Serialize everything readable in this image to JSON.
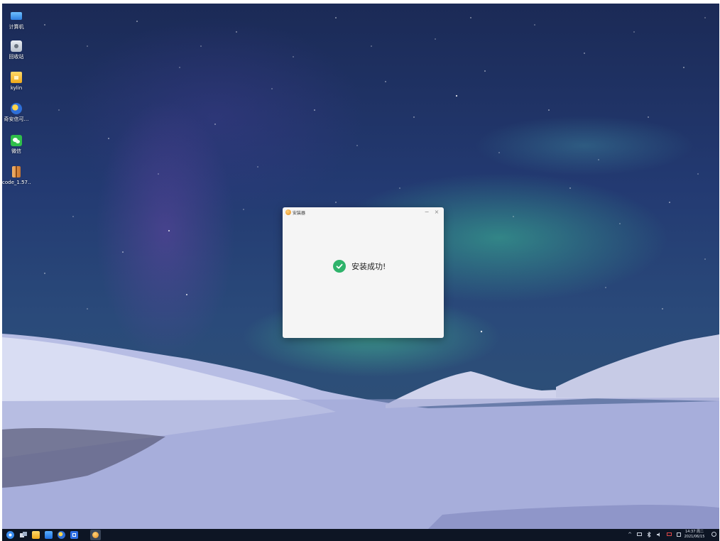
{
  "desktop": {
    "icons": [
      {
        "label": "计算机",
        "icon": "computer-icon"
      },
      {
        "label": "回收站",
        "icon": "trash-icon"
      },
      {
        "label": "kylin",
        "icon": "home-folder-icon"
      },
      {
        "label": "奇安信可…",
        "icon": "qianxin-browser-icon"
      },
      {
        "label": "微信",
        "icon": "wechat-icon"
      },
      {
        "label": "code_1.57…",
        "icon": "package-icon"
      }
    ]
  },
  "dialog": {
    "title": "安装器",
    "minimize_glyph": "−",
    "close_glyph": "×",
    "message": "安装成功!",
    "accent_color": "#2fb36b"
  },
  "taskbar": {
    "apps": [
      "start-menu-icon",
      "multitask-view-icon",
      "file-manager-icon",
      "software-store-icon",
      "browser-icon",
      "wps-writer-icon",
      "installer-icon"
    ],
    "tray_icons": [
      "tray-expand-icon",
      "keyboard-icon",
      "bluetooth-icon",
      "volume-icon",
      "network-icon",
      "clipboard-icon"
    ],
    "tray_expand_glyph": "^",
    "clock_time": "14:37 周二",
    "clock_date": "2021/06/15"
  }
}
